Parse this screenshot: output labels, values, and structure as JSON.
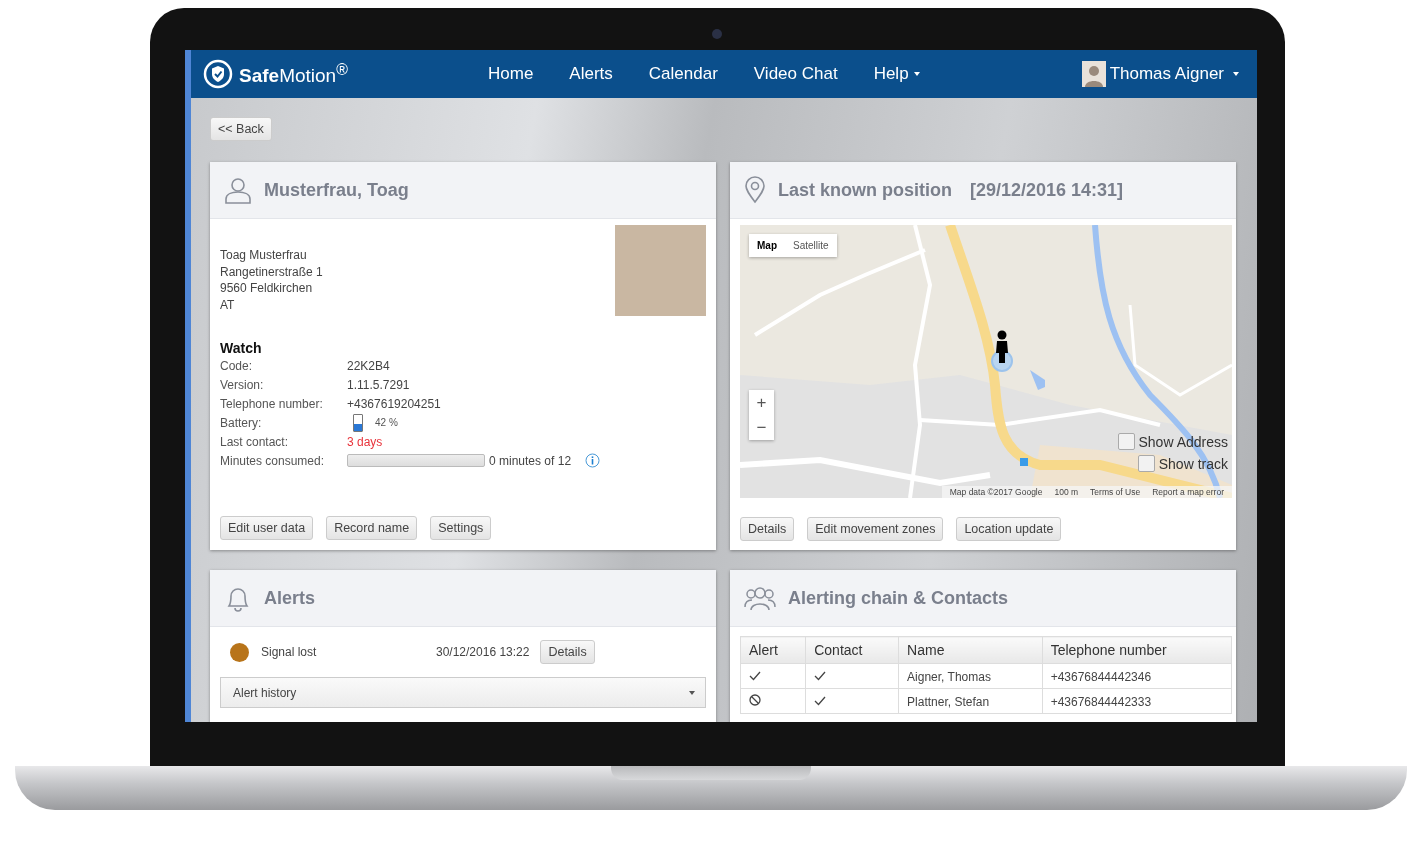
{
  "brand": {
    "name": "**Safe**Motion$^{®}$"
  },
  "nav": [
    {
      "label": "Home",
      "dropdown": false
    },
    {
      "label": "Alerts",
      "dropdown": false
    },
    {
      "label": "Calendar",
      "dropdown": false
    },
    {
      "label": "Video Chat",
      "dropdown": false
    },
    {
      "label": "Help",
      "dropdown": true
    }
  ],
  "user": {
    "name": "Thomas Aigner",
    "dropdown": true
  },
  "back_button": "<< Back",
  "person_card": {
    "title": "Musterfrau, Toag",
    "address": [
      "Toag Musterfrau",
      "Rangetinerstraße 1",
      "9560 Feldkirchen",
      "AT"
    ],
    "watch": {
      "title": "Watch",
      "fields": [
        {
          "kind": "text",
          "label": "Code:",
          "value": "22K2B4"
        },
        {
          "kind": "text",
          "label": "Version:",
          "value": "1.11.5.7291"
        },
        {
          "kind": "text",
          "label": "Telephone number:",
          "value": "+4367619204251"
        },
        {
          "kind": "battery",
          "label": "Battery:",
          "level": 0.42,
          "value": "42 %"
        },
        {
          "kind": "warning",
          "label": "Last contact:",
          "value": "3 days"
        },
        {
          "kind": "progress",
          "label": "Minutes consumed:",
          "level": 0,
          "value": "0 minutes of 12"
        }
      ]
    },
    "buttons": [
      "Edit user data",
      "Record name",
      "Settings"
    ]
  },
  "position_card": {
    "title": "Last known position",
    "timestamp": "[29/12/2016 14:31]",
    "map": {
      "types": [
        {
          "label": "Map",
          "selected": true
        },
        {
          "label": "Satellite",
          "selected": false
        }
      ],
      "zoom": [
        "+",
        "−"
      ],
      "options": [
        {
          "label": "Show Address",
          "checked": false
        },
        {
          "label": "Show track",
          "checked": false
        }
      ],
      "attribution": [
        "Map data ©2017 Google",
        "100 m",
        "Terms of Use",
        "Report a map error"
      ]
    },
    "buttons": [
      "Details",
      "Edit movement zones",
      "Location update"
    ]
  },
  "alerts_card": {
    "title": "Alerts",
    "alerts": [
      {
        "label": "Signal lost",
        "time": "30/12/2016 13:22",
        "color": "#b8741a",
        "button": "Details"
      }
    ],
    "history": "Alert history"
  },
  "contacts_card": {
    "title": "Alerting chain & Contacts",
    "columns": [
      "Alert",
      "Contact",
      "Name",
      "Telephone number"
    ],
    "rows": [
      {
        "alert": true,
        "contact": true,
        "name": "Aigner, Thomas",
        "phone": "+43676844442346"
      },
      {
        "alert": false,
        "contact": true,
        "name": "Plattner, Stefan",
        "phone": "+43676844442333"
      }
    ]
  }
}
